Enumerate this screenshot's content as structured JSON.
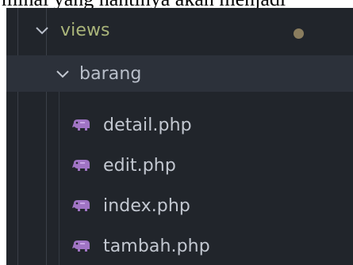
{
  "caption": {
    "text": "minal yang nantinya akan menjadi"
  },
  "tree": {
    "root_folder": {
      "label": "views",
      "icon": "chevron-down-icon",
      "expanded": true,
      "modified_indicator_color": "#8a7d5e"
    },
    "sub_folder": {
      "label": "barang",
      "icon": "chevron-down-icon",
      "expanded": true
    },
    "files": [
      {
        "label": "detail.php",
        "icon": "php-elephant-icon"
      },
      {
        "label": "edit.php",
        "icon": "php-elephant-icon"
      },
      {
        "label": "index.php",
        "icon": "php-elephant-icon"
      },
      {
        "label": "tambah.php",
        "icon": "php-elephant-icon"
      }
    ]
  },
  "colors": {
    "background": "#21252b",
    "selected_row": "#2c313a",
    "folder_text": "#aab57a",
    "file_text": "#c3c8d1",
    "php_icon": "#a074c4"
  }
}
